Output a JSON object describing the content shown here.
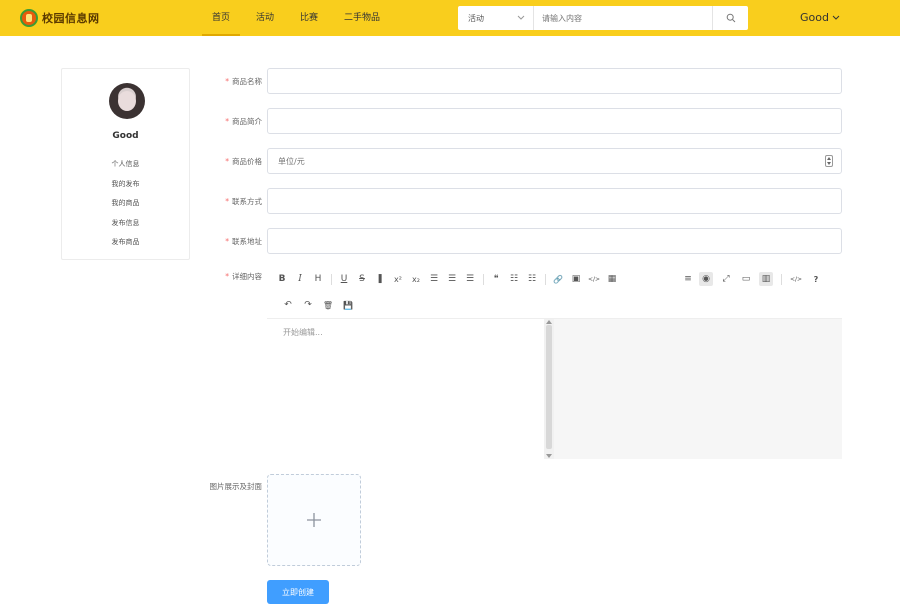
{
  "header": {
    "logo_text": "校园信息网",
    "nav": [
      "首页",
      "活动",
      "比赛",
      "二手物品"
    ],
    "search": {
      "category": "活动",
      "placeholder": "请输入内容"
    },
    "user": "Good"
  },
  "sidebar": {
    "username": "Good",
    "links": [
      "个人信息",
      "我的发布",
      "我的商品",
      "发布信息",
      "发布商品"
    ]
  },
  "form": {
    "fields": [
      {
        "label": "商品名称",
        "placeholder": ""
      },
      {
        "label": "商品简介",
        "placeholder": ""
      },
      {
        "label": "商品价格",
        "placeholder": "单位/元"
      },
      {
        "label": "联系方式",
        "placeholder": ""
      },
      {
        "label": "联系地址",
        "placeholder": ""
      }
    ],
    "editor": {
      "label": "详细内容",
      "placeholder": "开始编辑...",
      "toolbar_row1": [
        "B",
        "I",
        "H",
        "U",
        "S",
        "❚",
        "x²",
        "x₂",
        "☰",
        "☰",
        "☰",
        "❝",
        "☷",
        "☷",
        "🔗",
        "▣",
        "</>",
        "▦",
        "≡",
        "◉",
        "⤢",
        "▭",
        "▥",
        "</>",
        "?"
      ],
      "toolbar_row2": [
        "↶",
        "↷",
        "🗑",
        "💾"
      ]
    },
    "upload_label": "图片展示及封面",
    "submit_label": "立即创建"
  },
  "colors": {
    "header_bg": "#f9ce1d",
    "primary": "#409eff",
    "required": "#f56c6c"
  }
}
